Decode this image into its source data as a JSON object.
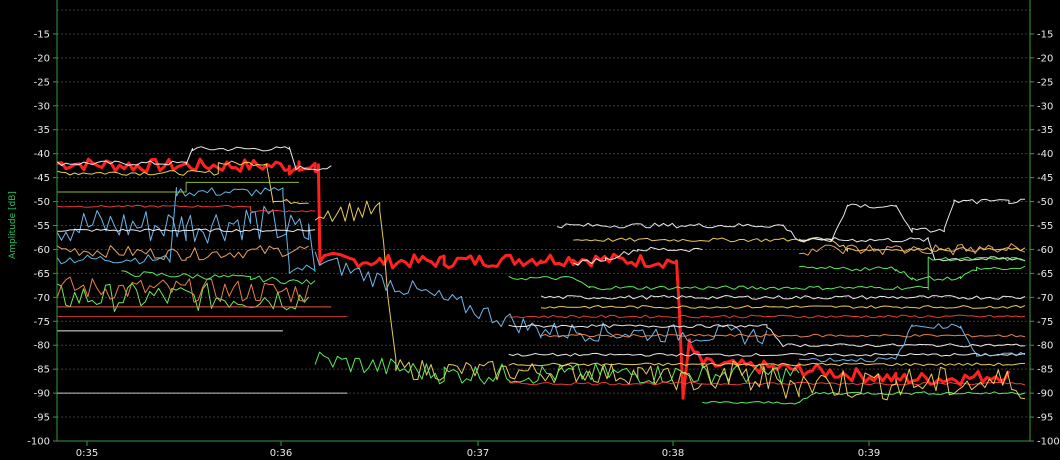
{
  "chart_data": {
    "type": "line",
    "title": "",
    "ylabel": "Amplitude [dB]",
    "ylim": [
      -100,
      -10
    ],
    "y_ticks": [
      "-15",
      "-20",
      "-25",
      "-30",
      "-35",
      "-40",
      "-45",
      "-50",
      "-55",
      "-60",
      "-65",
      "-70",
      "-75",
      "-80",
      "-85",
      "-90",
      "-95",
      "-100"
    ],
    "x_ticks": [
      "0:35",
      "0:36",
      "0:37",
      "0:38",
      "0:39"
    ],
    "xlim_seconds": [
      2098,
      2160
    ],
    "x_tick_seconds": [
      2100,
      2160,
      2220,
      2280,
      2340
    ],
    "grid": true,
    "colors": {
      "background": "#000000",
      "axis": "#3a9a3a",
      "grid": "#3a3a3a",
      "tick_label": "#e8e8e8",
      "ylabel": "#22c55e",
      "highlight": "#ff2020"
    },
    "series": [
      {
        "color": "#ff2020",
        "width": 3,
        "noise": 1.4,
        "points": [
          [
            0,
            -42
          ],
          [
            0.25,
            -42.5
          ],
          [
            0.72,
            -42.5
          ],
          [
            0.72,
            -43
          ],
          [
            0.75,
            -43
          ],
          [
            0.75,
            -43
          ],
          [
            0.78,
            -43
          ],
          [
            0.8,
            -43
          ],
          [
            0.8,
            -43
          ],
          [
            0.81,
            -43
          ],
          [
            0.815,
            -62
          ],
          [
            1.0,
            -62.5
          ],
          [
            1.2,
            -62.5
          ],
          [
            1.5,
            -62
          ],
          [
            1.6,
            -62
          ],
          [
            1.92,
            -62.5
          ],
          [
            1.93,
            -75
          ],
          [
            1.94,
            -90
          ],
          [
            1.96,
            -80
          ],
          [
            2.0,
            -84
          ],
          [
            2.3,
            -85
          ],
          [
            2.6,
            -87
          ],
          [
            2.8,
            -87
          ],
          [
            2.95,
            -86
          ]
        ]
      },
      {
        "color": "#ffffff",
        "width": 1,
        "noise": 0.5,
        "points": [
          [
            0,
            -42
          ],
          [
            0.4,
            -42
          ],
          [
            0.42,
            -39
          ],
          [
            0.72,
            -39
          ],
          [
            0.74,
            -43
          ],
          [
            0.85,
            -43
          ]
        ]
      },
      {
        "color": "#ffe066",
        "width": 1,
        "noise": 0.5,
        "points": [
          [
            0,
            -44
          ],
          [
            0.5,
            -44
          ],
          [
            0.5,
            -42
          ],
          [
            0.65,
            -42
          ],
          [
            0.67,
            -50
          ],
          [
            0.78,
            -50
          ]
        ]
      },
      {
        "color": "#7fc8ff",
        "width": 1,
        "noise": 4,
        "points": [
          [
            0,
            -55
          ],
          [
            0.4,
            -55
          ],
          [
            0.6,
            -54
          ],
          [
            0.78,
            -57
          ],
          [
            0.8,
            -62
          ]
        ]
      },
      {
        "color": "#ffb070",
        "width": 1,
        "noise": 1.3,
        "points": [
          [
            0,
            -60
          ],
          [
            0.4,
            -61
          ],
          [
            0.78,
            -60
          ]
        ]
      },
      {
        "color": "#80ff60",
        "width": 1,
        "noise": 3,
        "points": [
          [
            0,
            -70
          ],
          [
            0.78,
            -70
          ]
        ]
      },
      {
        "color": "#ff8c50",
        "width": 1,
        "noise": 2.5,
        "points": [
          [
            0,
            -68
          ],
          [
            0.78,
            -69
          ]
        ]
      },
      {
        "color": "#66ccff",
        "width": 1,
        "noise": 1,
        "points": [
          [
            0,
            -62
          ],
          [
            0.35,
            -62
          ],
          [
            0.37,
            -48
          ],
          [
            0.7,
            -48
          ],
          [
            0.72,
            -64
          ],
          [
            0.8,
            -64
          ]
        ]
      },
      {
        "color": "#ffffff",
        "width": 1,
        "noise": 0.3,
        "points": [
          [
            0,
            -56
          ],
          [
            0.8,
            -56
          ]
        ]
      },
      {
        "color": "#ff4040",
        "width": 1,
        "noise": 0.2,
        "points": [
          [
            0,
            -51
          ],
          [
            0.6,
            -51
          ],
          [
            0.6,
            -52
          ],
          [
            0.8,
            -52
          ]
        ]
      },
      {
        "color": "#9acd32",
        "width": 1,
        "noise": 0,
        "points": [
          [
            0,
            -48
          ],
          [
            0.4,
            -48
          ],
          [
            0.4,
            -46
          ],
          [
            0.75,
            -46
          ]
        ]
      },
      {
        "color": "#cc3333",
        "width": 1,
        "noise": 0,
        "points": [
          [
            0,
            -74
          ],
          [
            0.9,
            -74
          ]
        ]
      },
      {
        "color": "#ff6060",
        "width": 1,
        "noise": 0,
        "points": [
          [
            0,
            -72
          ],
          [
            0.85,
            -72
          ]
        ]
      },
      {
        "color": "#ffffff",
        "width": 1,
        "noise": 0,
        "points": [
          [
            0,
            -77
          ],
          [
            0.7,
            -77
          ]
        ]
      },
      {
        "color": "#dddddd",
        "width": 1,
        "noise": 0,
        "points": [
          [
            0,
            -90
          ],
          [
            0.9,
            -90
          ]
        ]
      },
      {
        "color": "#66ff66",
        "width": 1,
        "noise": 0.6,
        "points": [
          [
            0.2,
            -65
          ],
          [
            0.6,
            -66
          ],
          [
            0.8,
            -67
          ]
        ]
      },
      {
        "color": "#ffe066",
        "width": 1,
        "noise": 2.2,
        "points": [
          [
            0.8,
            -52
          ],
          [
            1.0,
            -52
          ],
          [
            1.05,
            -85
          ],
          [
            1.8,
            -86
          ],
          [
            2.0,
            -88
          ]
        ]
      },
      {
        "color": "#66ff66",
        "width": 1,
        "noise": 2.2,
        "points": [
          [
            0.8,
            -83
          ],
          [
            1.2,
            -86
          ],
          [
            1.6,
            -86
          ],
          [
            2.0,
            -86
          ],
          [
            2.3,
            -86
          ]
        ]
      },
      {
        "color": "#7fc8ff",
        "width": 1,
        "noise": 2,
        "points": [
          [
            0.8,
            -62
          ],
          [
            1.5,
            -77
          ],
          [
            2.2,
            -78
          ]
        ]
      },
      {
        "color": "#ffffff",
        "width": 1,
        "noise": 0.5,
        "points": [
          [
            1.6,
            -63
          ],
          [
            1.7,
            -62
          ],
          [
            1.8,
            -60
          ],
          [
            2.0,
            -60
          ]
        ]
      },
      {
        "color": "#ffffff",
        "width": 1,
        "noise": 0.5,
        "points": [
          [
            1.55,
            -55
          ],
          [
            2.25,
            -55
          ],
          [
            2.3,
            -58
          ],
          [
            2.7,
            -58
          ],
          [
            2.72,
            -62
          ],
          [
            3.0,
            -62
          ]
        ]
      },
      {
        "color": "#ffe066",
        "width": 1,
        "noise": 0.4,
        "points": [
          [
            1.6,
            -58
          ],
          [
            2.4,
            -58
          ],
          [
            2.45,
            -60
          ],
          [
            3.0,
            -60
          ]
        ]
      },
      {
        "color": "#66ff66",
        "width": 1,
        "noise": 0.4,
        "points": [
          [
            1.4,
            -66
          ],
          [
            1.6,
            -66
          ],
          [
            1.65,
            -68
          ],
          [
            2.7,
            -68
          ],
          [
            2.7,
            -62
          ],
          [
            3.0,
            -62
          ]
        ]
      },
      {
        "color": "#ffffff",
        "width": 1,
        "noise": 0.4,
        "points": [
          [
            1.5,
            -70
          ],
          [
            3.0,
            -70
          ]
        ]
      },
      {
        "color": "#ffe066",
        "width": 1,
        "noise": 0.3,
        "points": [
          [
            1.5,
            -72
          ],
          [
            3.0,
            -72
          ]
        ]
      },
      {
        "color": "#ff4040",
        "width": 1,
        "noise": 0.3,
        "points": [
          [
            1.4,
            -74
          ],
          [
            3.0,
            -74
          ]
        ]
      },
      {
        "color": "#ffffff",
        "width": 1,
        "noise": 0.3,
        "points": [
          [
            1.4,
            -76
          ],
          [
            2.2,
            -76
          ],
          [
            2.25,
            -80
          ],
          [
            3.0,
            -80
          ]
        ]
      },
      {
        "color": "#ff8c50",
        "width": 1,
        "noise": 0.3,
        "points": [
          [
            1.5,
            -78
          ],
          [
            3.0,
            -78
          ]
        ]
      },
      {
        "color": "#ffffff",
        "width": 1,
        "noise": 0.3,
        "points": [
          [
            1.4,
            -82
          ],
          [
            3.0,
            -82
          ]
        ]
      },
      {
        "color": "#ffe066",
        "width": 1,
        "noise": 0.3,
        "points": [
          [
            1.4,
            -84
          ],
          [
            3.0,
            -84
          ]
        ]
      },
      {
        "color": "#ff4040",
        "width": 1,
        "noise": 0.3,
        "points": [
          [
            1.4,
            -88
          ],
          [
            3.0,
            -88
          ]
        ]
      },
      {
        "color": "#66ff66",
        "width": 1,
        "noise": 0.3,
        "points": [
          [
            2.0,
            -92
          ],
          [
            2.3,
            -92
          ],
          [
            2.35,
            -90
          ],
          [
            3.0,
            -90
          ]
        ]
      },
      {
        "color": "#ffb070",
        "width": 1,
        "noise": 1.3,
        "points": [
          [
            2.3,
            -60
          ],
          [
            2.9,
            -60
          ],
          [
            3.0,
            -60
          ]
        ]
      },
      {
        "color": "#ffffff",
        "width": 1,
        "noise": 0.5,
        "points": [
          [
            2.3,
            -58
          ],
          [
            2.4,
            -58
          ],
          [
            2.45,
            -51
          ],
          [
            2.6,
            -51
          ],
          [
            2.65,
            -56
          ],
          [
            2.75,
            -56
          ],
          [
            2.78,
            -50
          ],
          [
            2.95,
            -50
          ],
          [
            3.0,
            -50
          ]
        ]
      },
      {
        "color": "#66ff66",
        "width": 1,
        "noise": 0.5,
        "points": [
          [
            2.3,
            -64
          ],
          [
            2.6,
            -64
          ],
          [
            2.65,
            -66
          ],
          [
            2.8,
            -66
          ],
          [
            2.85,
            -64
          ],
          [
            3.0,
            -64
          ]
        ]
      },
      {
        "color": "#ffe066",
        "width": 1,
        "noise": 3.5,
        "points": [
          [
            2.0,
            -86
          ],
          [
            2.3,
            -88
          ],
          [
            2.6,
            -88
          ],
          [
            3.0,
            -88
          ]
        ]
      },
      {
        "color": "#7fc8ff",
        "width": 1,
        "noise": 0.5,
        "points": [
          [
            2.3,
            -83
          ],
          [
            2.6,
            -83
          ],
          [
            2.65,
            -76
          ],
          [
            2.8,
            -76
          ],
          [
            2.85,
            -82
          ],
          [
            3.0,
            -82
          ]
        ]
      }
    ]
  }
}
